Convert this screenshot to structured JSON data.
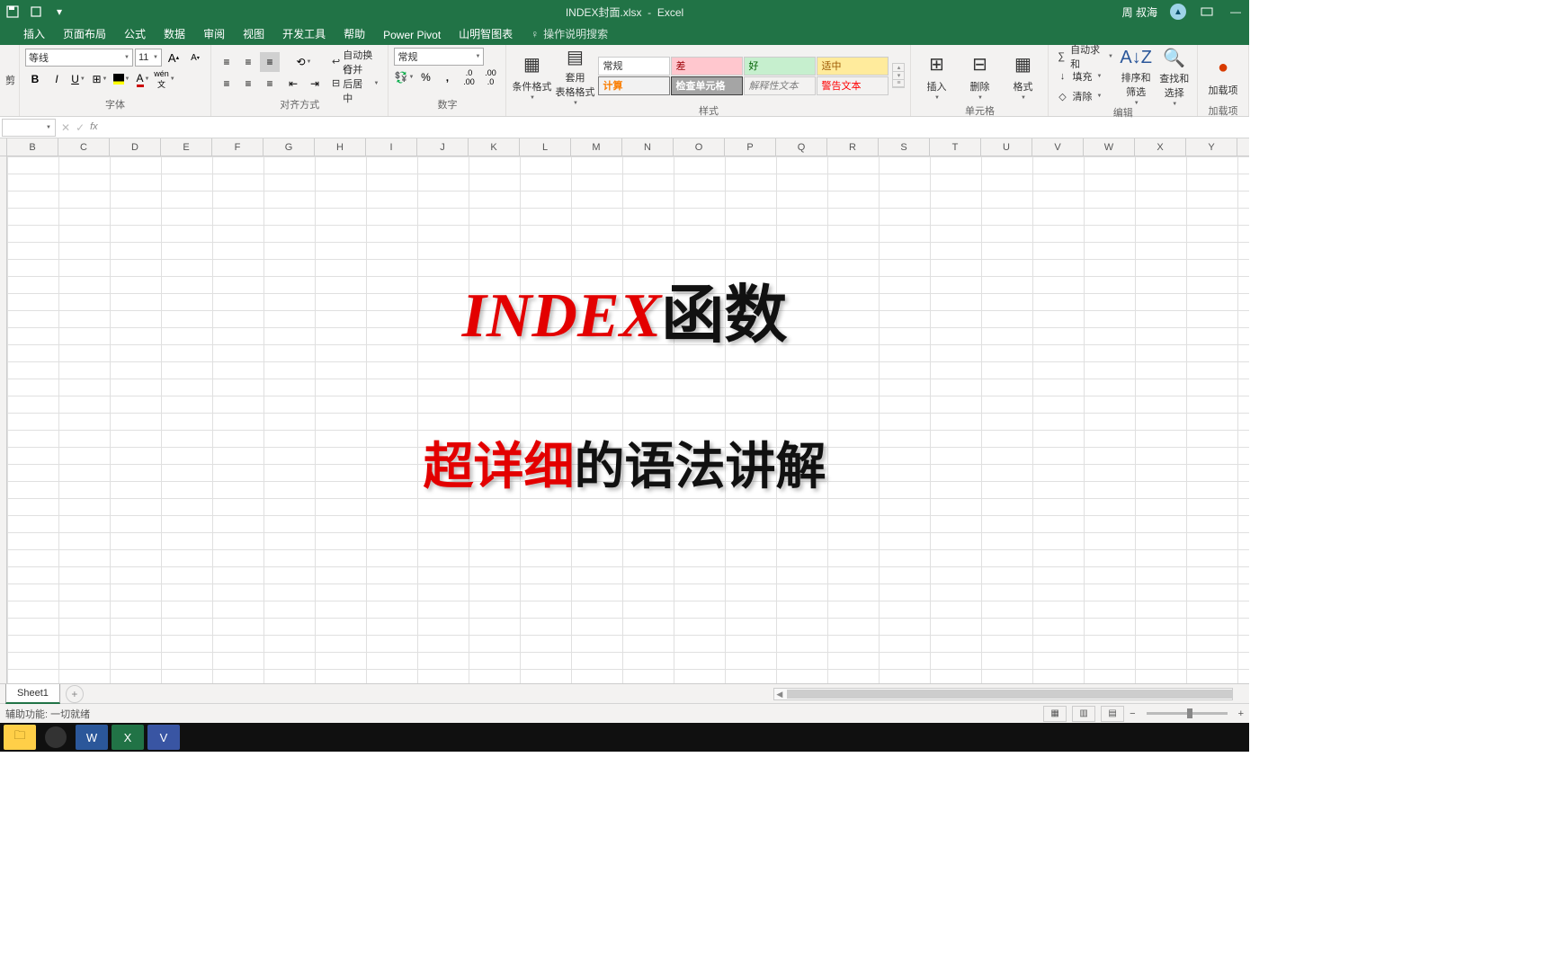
{
  "title": {
    "filename": "INDEX封面.xlsx",
    "app": "Excel",
    "user": "周 叔海"
  },
  "qat": {
    "save": "💾",
    "undo": "↶",
    "redo": "↷"
  },
  "tabs": [
    "插入",
    "页面布局",
    "公式",
    "数据",
    "审阅",
    "视图",
    "开发工具",
    "帮助",
    "Power Pivot",
    "山明智图表"
  ],
  "tell_me": "操作说明搜索",
  "font": {
    "name": "等线",
    "size": "11",
    "bold": "B",
    "italic": "I",
    "underline": "U",
    "inc": "A",
    "dec": "A",
    "ruby": "⁂",
    "border": "⊞",
    "fill": "◆",
    "color": "A",
    "group": "字体"
  },
  "align": {
    "group": "对齐方式",
    "wrap": "自动换行",
    "merge": "合并后居中"
  },
  "number": {
    "format": "常规",
    "group": "数字",
    "currency": "¥",
    "percent": "%",
    "comma": ",",
    "inc": ".0",
    "dec": ".00"
  },
  "styles": {
    "cond": "条件格式",
    "table": "套用\n表格格式",
    "cells": [
      [
        "常规",
        "差",
        "好",
        "适中"
      ],
      [
        "计算",
        "检查单元格",
        "解释性文本",
        "警告文本"
      ]
    ],
    "group": "样式"
  },
  "cells_group": {
    "insert": "插入",
    "delete": "删除",
    "format": "格式",
    "group": "单元格"
  },
  "editing": {
    "sum": "自动求和",
    "fill": "填充",
    "clear": "清除",
    "sort": "排序和筛选",
    "find": "查找和选择",
    "group": "编辑"
  },
  "addins": {
    "label": "加载项",
    "group": "加载项"
  },
  "clipboard": {
    "label": "剪"
  },
  "columns": [
    "B",
    "C",
    "D",
    "E",
    "F",
    "G",
    "H",
    "I",
    "J",
    "K",
    "L",
    "M",
    "N",
    "O",
    "P",
    "Q",
    "R",
    "S",
    "T",
    "U",
    "V",
    "W",
    "X",
    "Y"
  ],
  "content": {
    "t1a": "INDEX",
    "t1b": "函数",
    "t2a": "超详细",
    "t2b": "的语法讲解"
  },
  "sheet": {
    "name": "Sheet1"
  },
  "status": {
    "ready": "辅助功能: 一切就绪",
    "zoom": ""
  }
}
